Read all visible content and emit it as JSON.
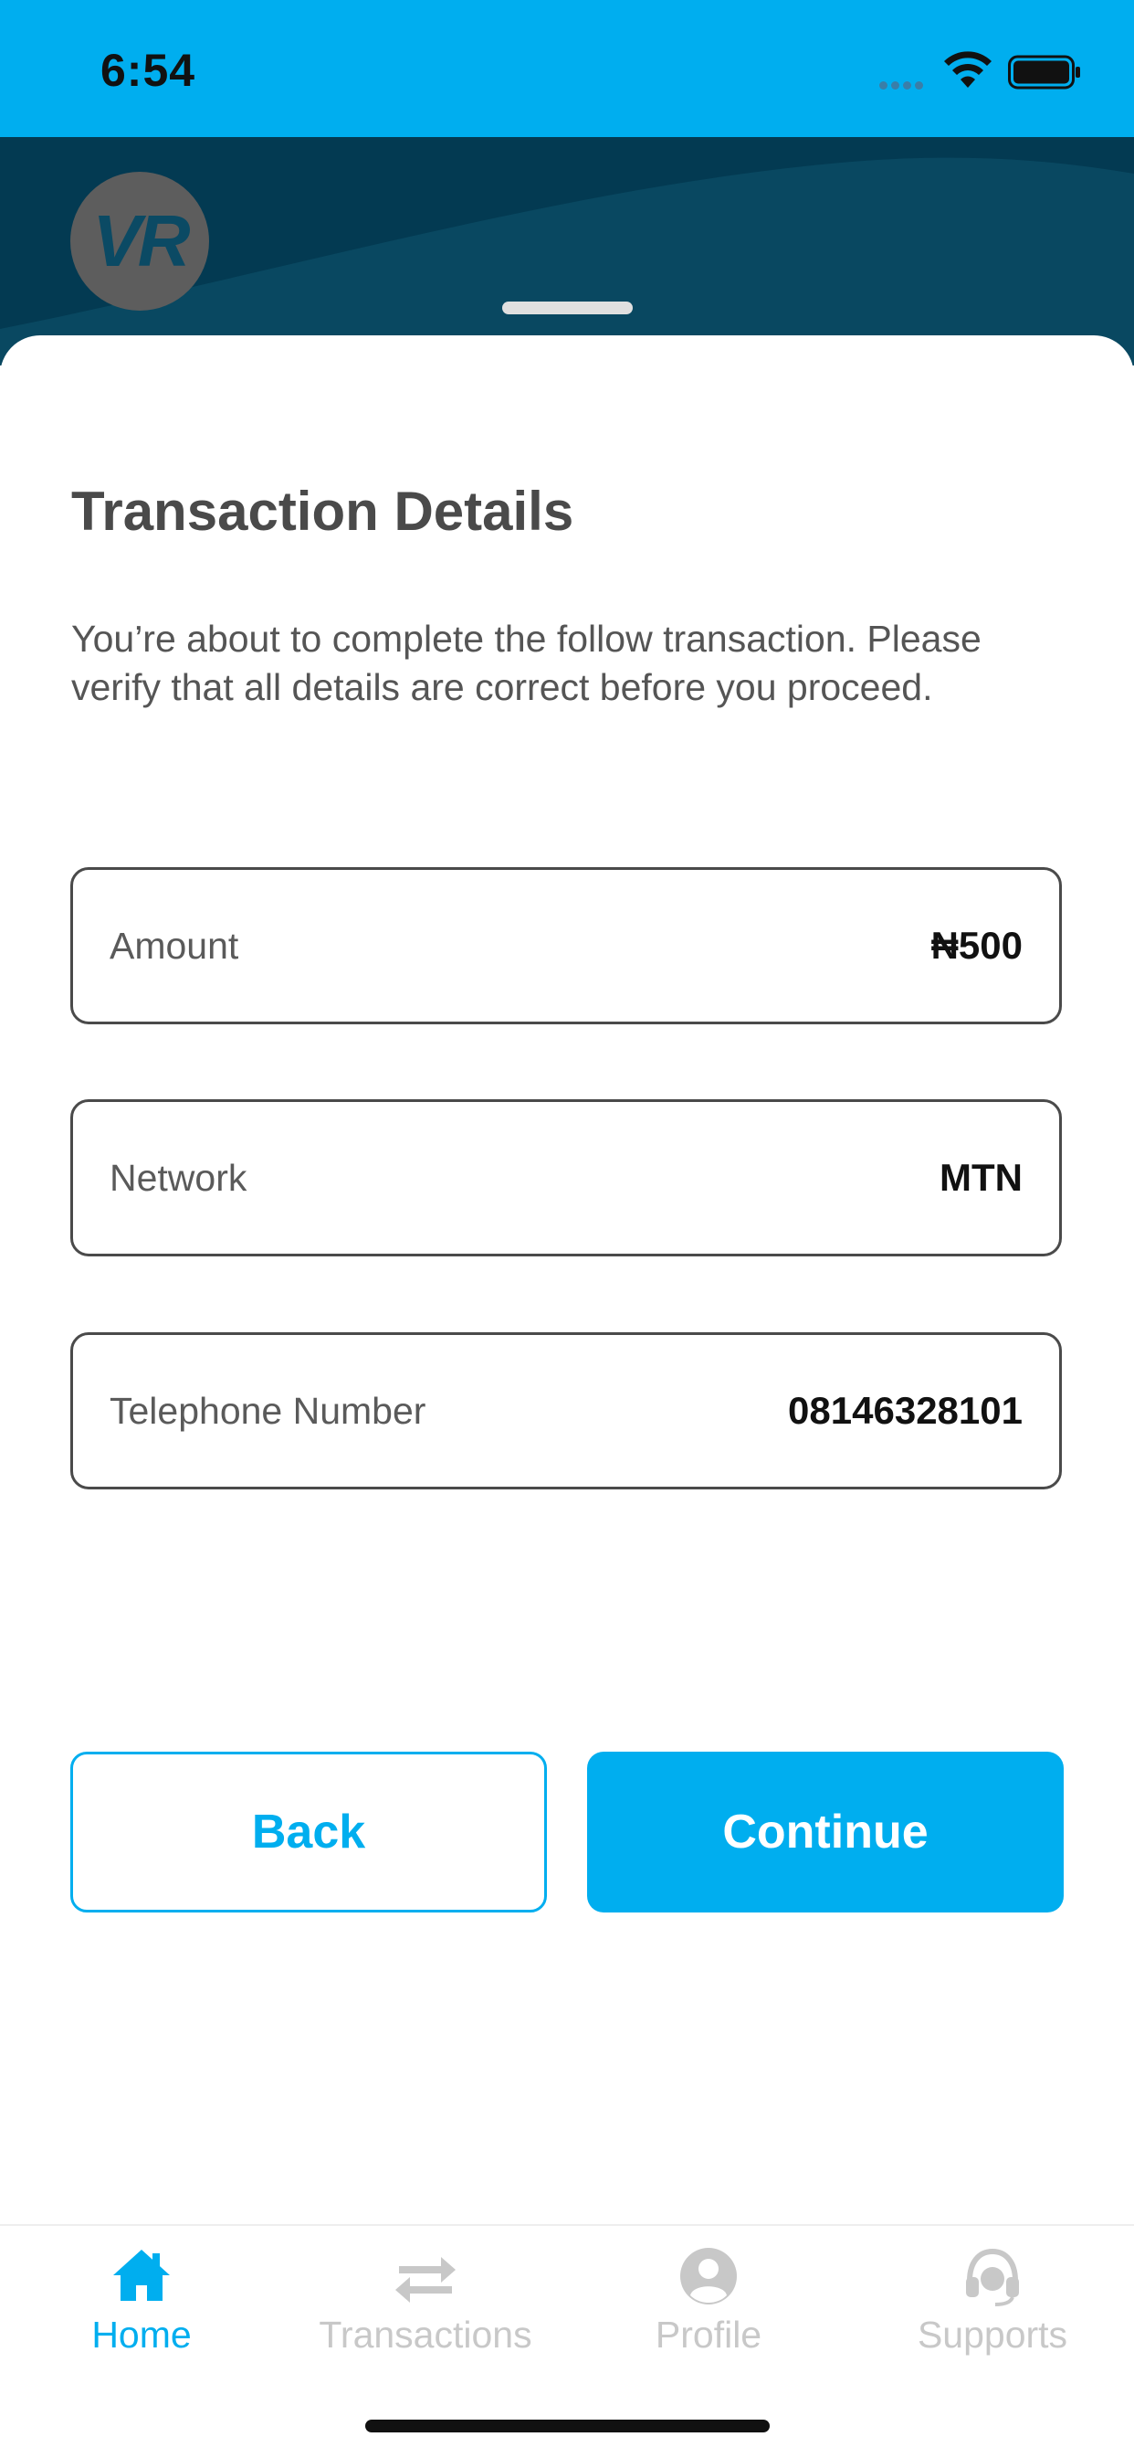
{
  "status_bar": {
    "time": "6:54"
  },
  "header": {
    "avatar_initials": "VR"
  },
  "page": {
    "title": "Transaction Details",
    "description": "You’re about to complete the follow transaction. Please verify that all details are correct before you proceed."
  },
  "details": [
    {
      "label": "Amount",
      "value": "₦500"
    },
    {
      "label": "Network",
      "value": "MTN"
    },
    {
      "label": "Telephone Number",
      "value": "08146328101"
    }
  ],
  "actions": {
    "back_label": "Back",
    "continue_label": "Continue"
  },
  "bottom_nav": {
    "items": [
      {
        "label": "Home",
        "icon": "home-icon",
        "active": true
      },
      {
        "label": "Transactions",
        "icon": "transfer-arrows-icon",
        "active": false
      },
      {
        "label": "Profile",
        "icon": "user-icon",
        "active": false
      },
      {
        "label": "Supports",
        "icon": "headset-icon",
        "active": false
      }
    ]
  },
  "colors": {
    "accent": "#00aeef",
    "header_dark": "#033a52",
    "title_text": "#4a4a4a",
    "inactive_nav": "#c8c8c8"
  }
}
